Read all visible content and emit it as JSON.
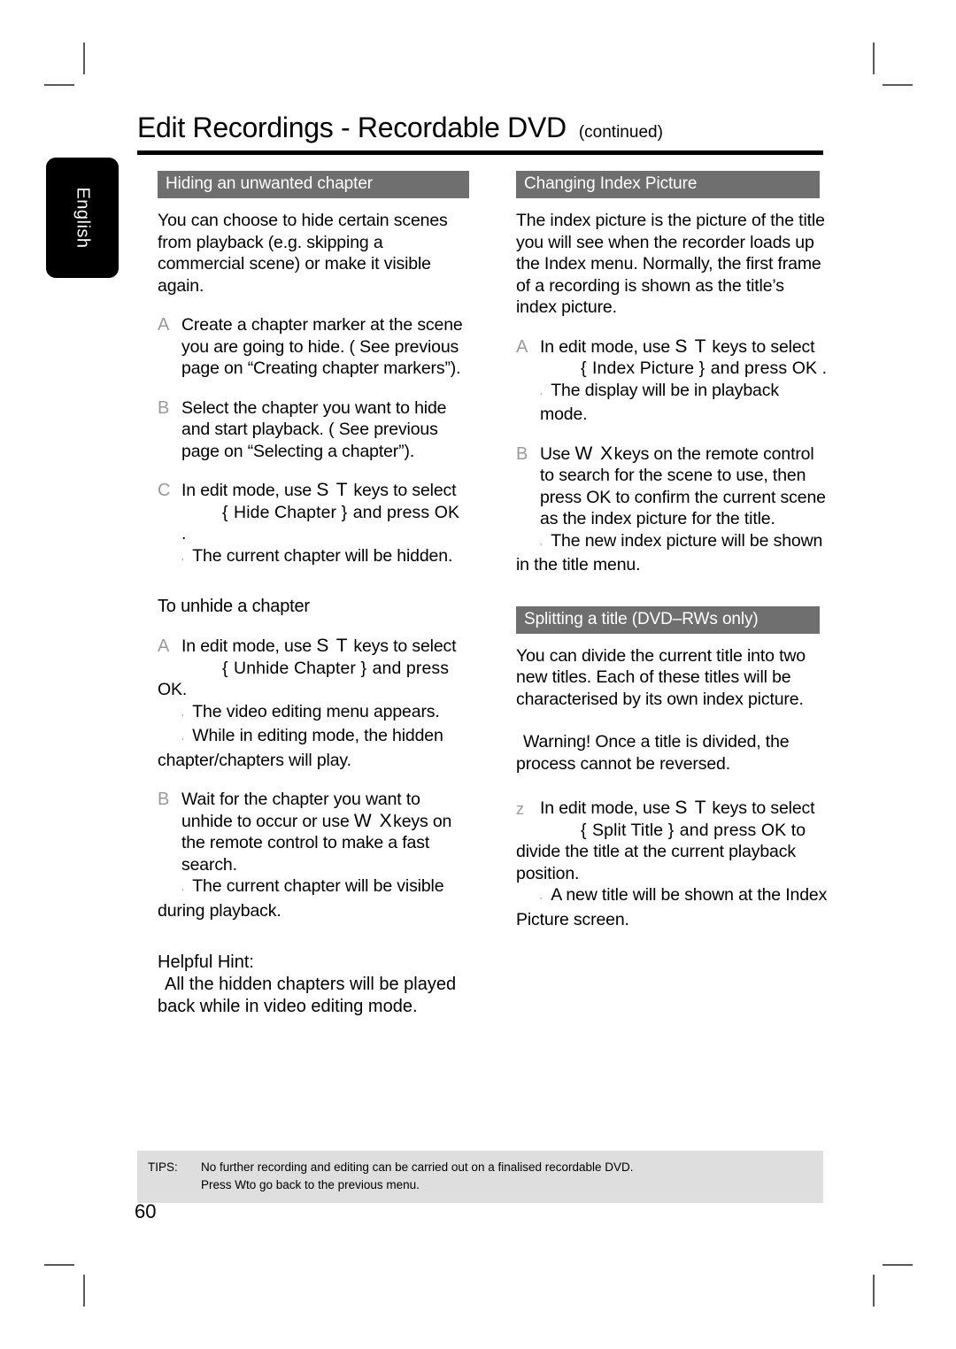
{
  "crop_marks": {
    "visible": true,
    "color": "#5a5a5a"
  },
  "language_tab": {
    "label": "English",
    "background": "#000000",
    "text_color": "#ffffff"
  },
  "header": {
    "title": "Edit Recordings - Recordable DVD",
    "continued": "(continued)",
    "rule_color": "#000000"
  },
  "theme": {
    "section_bar_bg": "#706f6f",
    "section_bar_text": "#ffffff",
    "step_marker_color": "#9a9a9a",
    "tips_bg": "#dedede"
  },
  "left_column": {
    "section_title": "Hiding an unwanted chapter",
    "intro": "You can choose to hide certain scenes from playback (e.g. skipping a commercial scene) or make it visible again.",
    "steps": [
      {
        "marker": "A",
        "text": "Create a chapter marker at the scene you are going to hide. ( See previous page on “Creating chapter markers”)."
      },
      {
        "marker": "B",
        "text": "Select the chapter you want to hide and start playback. ( See previous page on “Selecting a chapter”)."
      },
      {
        "marker": "C",
        "lead_pre": "In edit mode, use ",
        "keys": "S T",
        "lead_post": " keys to select",
        "menu_open": "{",
        "menu_item": " Hide Chapter ",
        "menu_close": "}",
        "menu_tail": " and press OK .",
        "result": "The current chapter will be hidden."
      }
    ],
    "unhide_heading": "To unhide a chapter",
    "unhide_steps": [
      {
        "marker": "A",
        "lead_pre": "In edit mode, use ",
        "keys": "S T",
        "lead_post": " keys to select",
        "menu_open": "{",
        "menu_item": " Unhide Chapter ",
        "menu_close": "}",
        "menu_tail": " and press",
        "menu_tail2": "OK.",
        "result1": "The video editing menu appears.",
        "result2": "While in editing mode, the hidden chapter/chapters will play."
      },
      {
        "marker": "B",
        "text_pre": "Wait for the chapter you want to unhide to occur or use ",
        "keys": "W X",
        "text_post": "keys on the remote control to make a fast search.",
        "result": "The current chapter will be visible during playback."
      }
    ],
    "hint_heading": "Helpful Hint:",
    "hint_body": "All the hidden chapters will be played back while in video editing mode."
  },
  "right_column": {
    "section_title_1": "Changing Index Picture",
    "intro_1": "The index picture is the picture of the title you will see when the recorder loads up the Index menu. Normally, the first frame of a recording is shown as the title’s index picture.",
    "steps_1": [
      {
        "marker": "A",
        "lead_pre": "In edit mode, use ",
        "keys": "S T",
        "lead_post": " keys to select",
        "menu_open": "{",
        "menu_item": " Index Picture ",
        "menu_close": "}",
        "menu_tail": " and press OK .",
        "result": "The display will be in playback mode."
      },
      {
        "marker": "B",
        "text_pre": "Use ",
        "keys": "W X",
        "text_post": "keys on the remote control to search for the scene to use, then press OK to confirm the current scene as the index picture for the title.",
        "result": "The new index picture will be shown in the title menu."
      }
    ],
    "section_title_2": "Splitting a title (DVD–RWs only)",
    "intro_2": "You can divide the current title into two new titles. Each of these titles will be characterised by its own index picture.",
    "warning": "Warning!  Once a title is divided, the process cannot be reversed.",
    "steps_2": [
      {
        "marker": "z",
        "lead_pre": "In edit mode, use ",
        "keys": "S T",
        "lead_post": " keys to select",
        "menu_open": "{",
        "menu_item": " Split Title ",
        "menu_close": "}",
        "menu_tail": " and press OK to",
        "menu_tail2": "divide the title at the current playback position.",
        "result": "A new title will be shown at the Index Picture screen."
      }
    ]
  },
  "footer": {
    "tips_label": "TIPS:",
    "tips_line1": "No further recording and editing can be carried out on a finalised recordable DVD.",
    "tips_line2_pre": "Press ",
    "tips_line2_key": "W",
    "tips_line2_post": "to go back to the previous menu.",
    "page_number": "60"
  }
}
